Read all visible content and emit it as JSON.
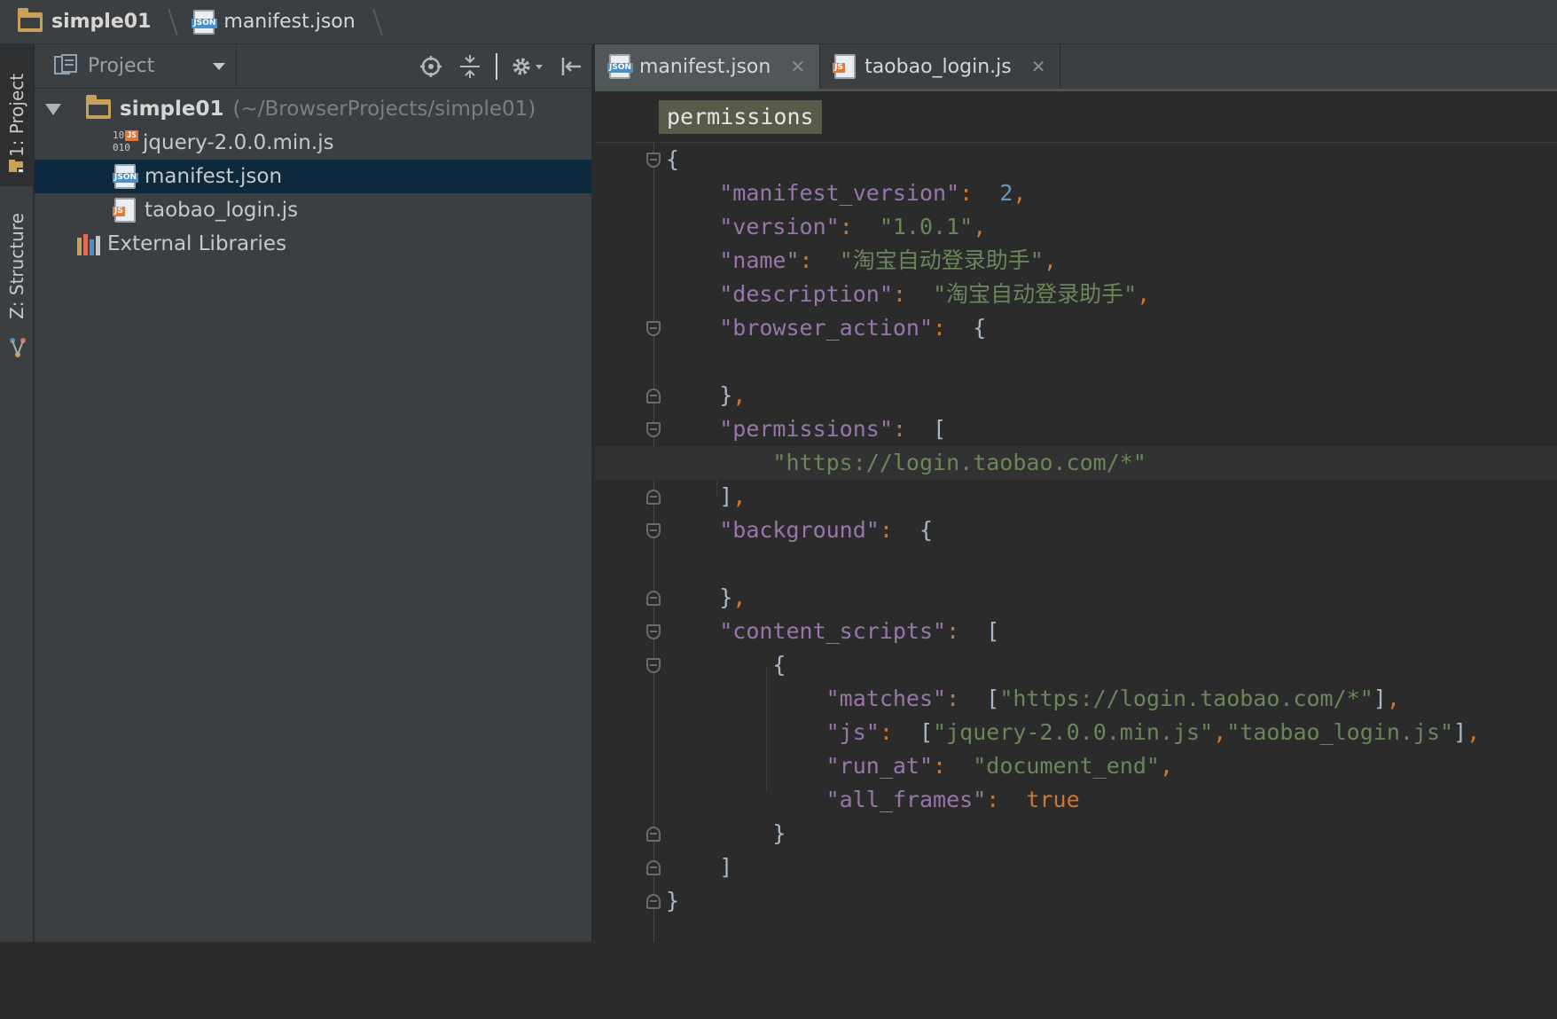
{
  "navbar": {
    "project": "simple01",
    "file": "manifest.json"
  },
  "toolstripe": {
    "project_tab": "1: Project",
    "structure_tab": "Z: Structure"
  },
  "project_panel": {
    "title": "Project",
    "tree": {
      "root_name": "simple01",
      "root_path": "(~/BrowserProjects/simple01)",
      "files": [
        "jquery-2.0.0.min.js",
        "manifest.json",
        "taobao_login.js"
      ],
      "external": "External Libraries"
    }
  },
  "editor": {
    "tabs": [
      {
        "label": "manifest.json",
        "icon": "json-file-icon"
      },
      {
        "label": "taobao_login.js",
        "icon": "js-file-icon"
      }
    ],
    "breadcrumb": "permissions",
    "code": {
      "open": "{",
      "manifest_version_key": "\"manifest_version\"",
      "manifest_version_val": "2",
      "version_key": "\"version\"",
      "version_val": "\"1.0.1\"",
      "name_key": "\"name\"",
      "name_val": "\"淘宝自动登录助手\"",
      "description_key": "\"description\"",
      "description_val": "\"淘宝自动登录助手\"",
      "browser_action_key": "\"browser_action\"",
      "permissions_key": "\"permissions\"",
      "permissions_item": "\"https://login.taobao.com/*\"",
      "background_key": "\"background\"",
      "content_scripts_key": "\"content_scripts\"",
      "matches_key": "\"matches\"",
      "matches_val": "\"https://login.taobao.com/*\"",
      "js_key": "\"js\"",
      "js_val_1": "\"jquery-2.0.0.min.js\"",
      "js_val_2": "\"taobao_login.js\"",
      "run_at_key": "\"run_at\"",
      "run_at_val": "\"document_end\"",
      "all_frames_key": "\"all_frames\"",
      "all_frames_val": "true",
      "close": "}"
    }
  },
  "colors": {
    "key": "#9876aa",
    "string": "#6a8759",
    "number": "#6897bb",
    "keyword": "#cc7832",
    "selection": "#0d293e"
  }
}
